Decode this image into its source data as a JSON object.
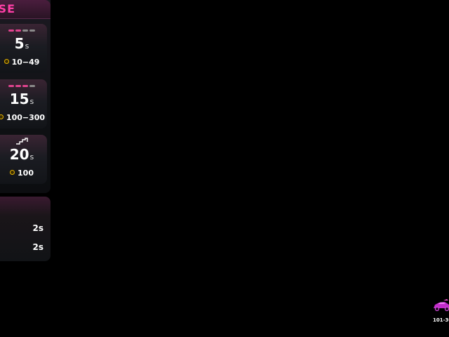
{
  "panel": {
    "title": "SE"
  },
  "cards": [
    {
      "seconds": "5",
      "unit": "s",
      "range": "10−49"
    },
    {
      "seconds": "15",
      "unit": "s",
      "range": "100−300"
    },
    {
      "seconds": "20",
      "unit": "s",
      "range": "100"
    }
  ],
  "lower_panel": {
    "rows": [
      {
        "value": "2s"
      },
      {
        "value": "2s"
      }
    ]
  },
  "car": {
    "range": "101-30"
  },
  "colors": {
    "accent": "#ff3fa7",
    "coin": "#e8b400",
    "bar_active": "#e2438f",
    "bar_inactive": "#8a8a8a"
  }
}
